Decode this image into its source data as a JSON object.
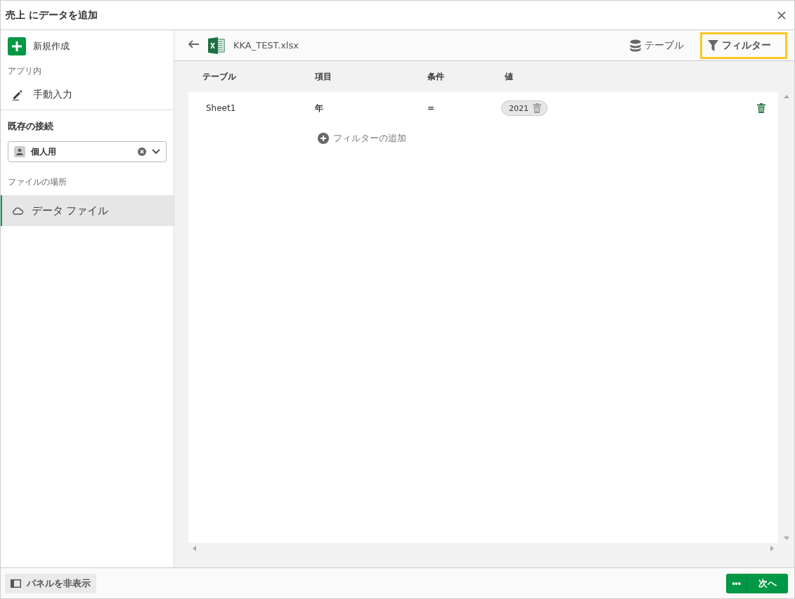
{
  "window": {
    "title": "売上 にデータを追加"
  },
  "sidebar": {
    "create": "新規作成",
    "in_app_heading": "アプリ内",
    "manual": "手動入力",
    "connections_heading": "既存の接続",
    "connection_select": {
      "value": "個人用"
    },
    "location_heading": "ファイルの場所",
    "items": [
      {
        "label": "データ ファイル",
        "selected": true
      }
    ]
  },
  "header": {
    "file_name": "KKA_TEST.xlsx",
    "tabs": [
      {
        "label": "テーブル",
        "kind": "table",
        "selected": false
      },
      {
        "label": "フィルター",
        "kind": "filter",
        "selected": true
      }
    ]
  },
  "table": {
    "columns": [
      "テーブル",
      "項目",
      "条件",
      "値"
    ],
    "rows": [
      {
        "table": "Sheet1",
        "field": "年",
        "condition": "=",
        "values": [
          "2021"
        ]
      }
    ],
    "add_filter": "フィルターの追加"
  },
  "footer": {
    "hide_panel": "パネルを非表示",
    "more": "•••",
    "next": "次へ"
  }
}
